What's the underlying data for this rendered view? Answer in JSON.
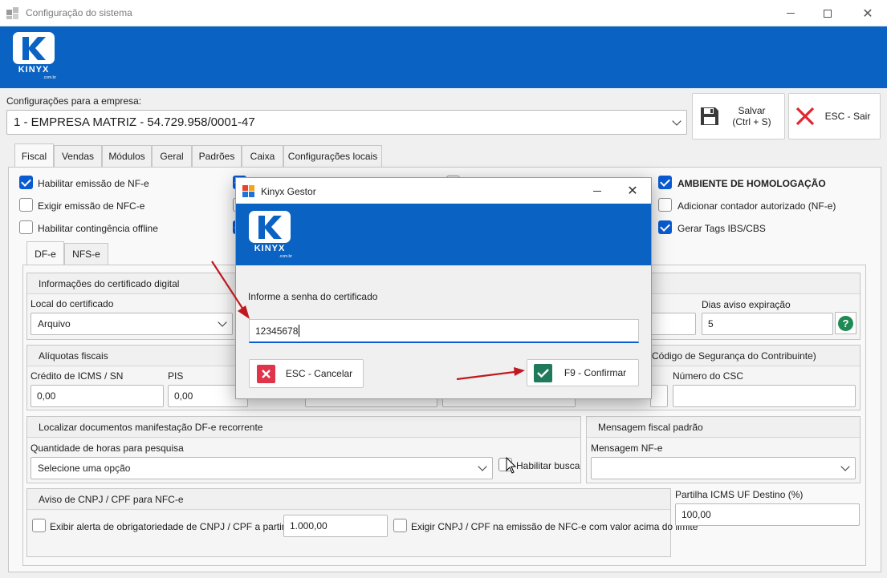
{
  "window": {
    "title": "Configuração do sistema"
  },
  "logo": {
    "brand": "KINYX",
    "domain": ".com.br"
  },
  "company": {
    "label": "Configurações para a empresa:",
    "selected": "1 - EMPRESA MATRIZ - 54.729.958/0001-47"
  },
  "actions": {
    "save_label": "Salvar",
    "save_shortcut": "(Ctrl + S)",
    "exit_label": "ESC - Sair"
  },
  "tabs": [
    "Fiscal",
    "Vendas",
    "Módulos",
    "Geral",
    "Padrões",
    "Caixa",
    "Configurações locais"
  ],
  "fiscal": {
    "check_nfe": "Habilitar emissão de NF-e",
    "check_nfce": "Exigir emissão de NFC-e",
    "check_offline": "Habilitar contingência offline",
    "check_homolog": "AMBIENTE DE HOMOLOGAÇÃO",
    "check_contador": "Adicionar contador autorizado (NF-e)",
    "check_ibs": "Gerar Tags IBS/CBS"
  },
  "subtabs": [
    "DF-e",
    "NFS-e"
  ],
  "cert": {
    "group_title": "Informações do certificado digital",
    "local_label": "Local do certificado",
    "local_value": "Arquivo",
    "dias_label": "Dias aviso expiração",
    "dias_value": "5"
  },
  "aliquotas": {
    "group_title": "Alíquotas fiscais",
    "icms_label": "Crédito de ICMS / SN",
    "icms_value": "0,00",
    "pis_label": "PIS",
    "pis_value": "0,00"
  },
  "csc": {
    "group_title": "Código de Segurança do Contribuinte)",
    "numero_label": "Número do CSC"
  },
  "manifest": {
    "group_title": "Localizar documentos manifestação DF-e recorrente",
    "horas_label": "Quantidade de horas para pesquisa",
    "horas_value": "Selecione uma opção",
    "habilitar_busca": "Habilitar busca"
  },
  "mensagem": {
    "group_title": "Mensagem fiscal padrão",
    "nfe_label": "Mensagem NF-e"
  },
  "aviso": {
    "group_title": "Aviso de CNPJ / CPF para NFC-e",
    "exibir_label": "Exibir alerta de obrigatoriedade de CNPJ / CPF a partir de:",
    "exibir_value": "1.000,00",
    "exigir_label": "Exigir CNPJ / CPF na emissão de NFC-e com valor acima do limite"
  },
  "partilha": {
    "label": "Partilha ICMS UF Destino (%)",
    "value": "100,00"
  },
  "modal": {
    "title": "Kinyx Gestor",
    "prompt": "Informe a senha do certificado",
    "password_value": "12345678",
    "cancel_label": "ESC - Cancelar",
    "confirm_label": "F9 - Confirmar"
  },
  "colors": {
    "brand_blue": "#0a62c2",
    "checkbox_blue": "#0a5bd2",
    "arrow_red": "#c0181f",
    "confirm_green": "#1e7a5a"
  }
}
